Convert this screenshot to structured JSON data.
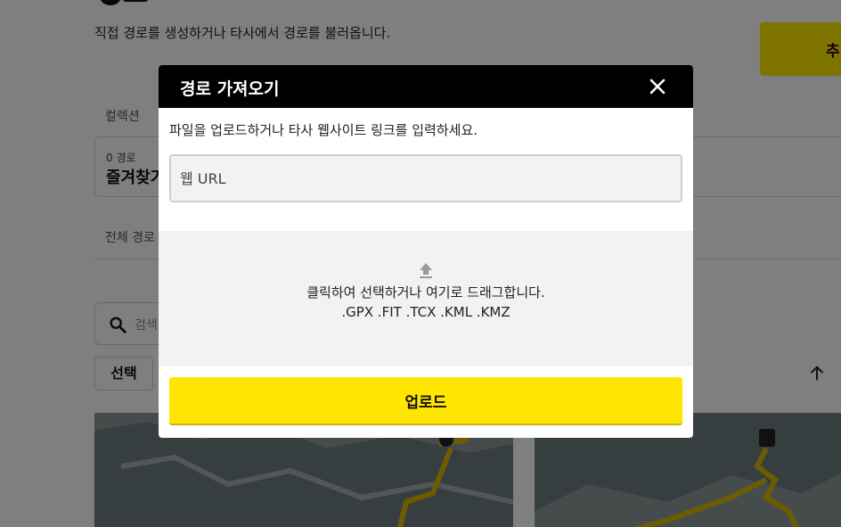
{
  "background": {
    "description": "직접 경로를 생성하거나 타사에서 경로를 불러옵니다.",
    "add_button_label": "추",
    "collection_label": "컬렉션",
    "favorites_card": {
      "count": "0 경로",
      "title": "즐겨찾기"
    },
    "all_routes_label": "전체 경로",
    "search_placeholder": "검색",
    "select_button_label": "선택"
  },
  "modal": {
    "title": "경로 가져오기",
    "instruction": "파일을 업로드하거나 타사 웹사이트 링크를 입력하세요.",
    "url_placeholder": "웹 URL",
    "url_value": "",
    "dropzone_text": "클릭하여 선택하거나 여기로 드래그합니다.",
    "dropzone_formats": ".GPX .FIT .TCX .KML .KMZ",
    "upload_button_label": "업로드"
  },
  "icons": {
    "close": "close-icon",
    "upload": "upload-icon",
    "search": "search-icon",
    "back_to_top": "arrow-up-icon"
  },
  "colors": {
    "accent": "#ffe600",
    "header": "#000000",
    "route_line": "#d8b800"
  }
}
